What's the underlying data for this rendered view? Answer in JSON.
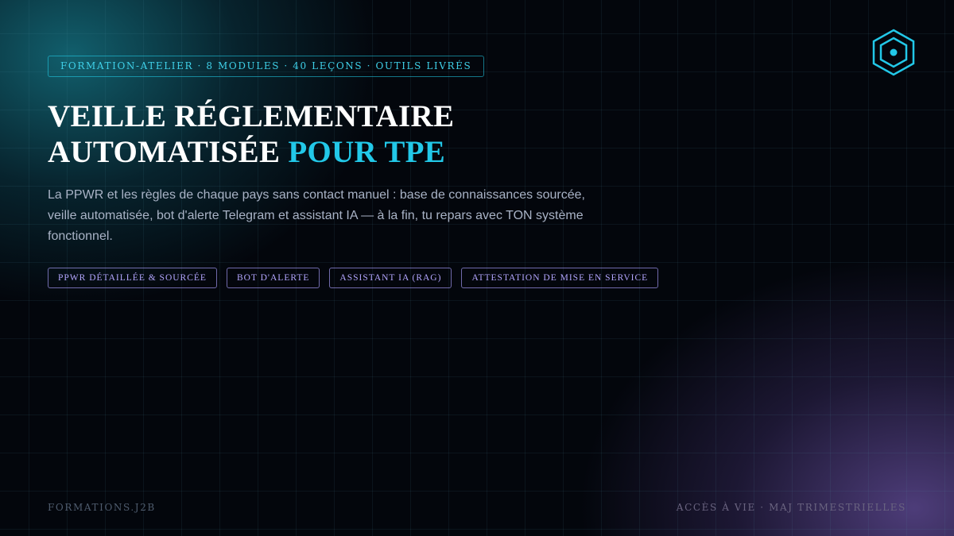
{
  "kicker": "FORMATION-ATELIER · 8 MODULES · 40 LEÇONS · OUTILS LIVRÉS",
  "title": {
    "line1": "VEILLE RÉGLEMENTAIRE",
    "line2_main": "AUTOMATISÉE ",
    "line2_accent": "POUR TPE"
  },
  "description": "La PPWR et les règles de chaque pays sans contact manuel : base de connaissances sourcée, veille automatisée, bot d'alerte Telegram et assistant IA — à la fin, tu repars avec TON système fonctionnel.",
  "tags": [
    "PPWR DÉTAILLÉE & SOURCÉE",
    "BOT D'ALERTE",
    "ASSISTANT IA (RAG)",
    "ATTESTATION DE MISE EN SERVICE"
  ],
  "footer": {
    "brand": "FORMATIONS.J2B",
    "note": "ACCÈS À VIE · MAJ TRIMESTRIELLES"
  },
  "logo": {
    "icon": "hexagon-icon",
    "color": "#22c8e8"
  },
  "colors": {
    "background": "#03060c",
    "accent_cyan": "#22c8e8",
    "accent_violet": "#b3a6ff",
    "text_muted": "#a9b3c6"
  }
}
